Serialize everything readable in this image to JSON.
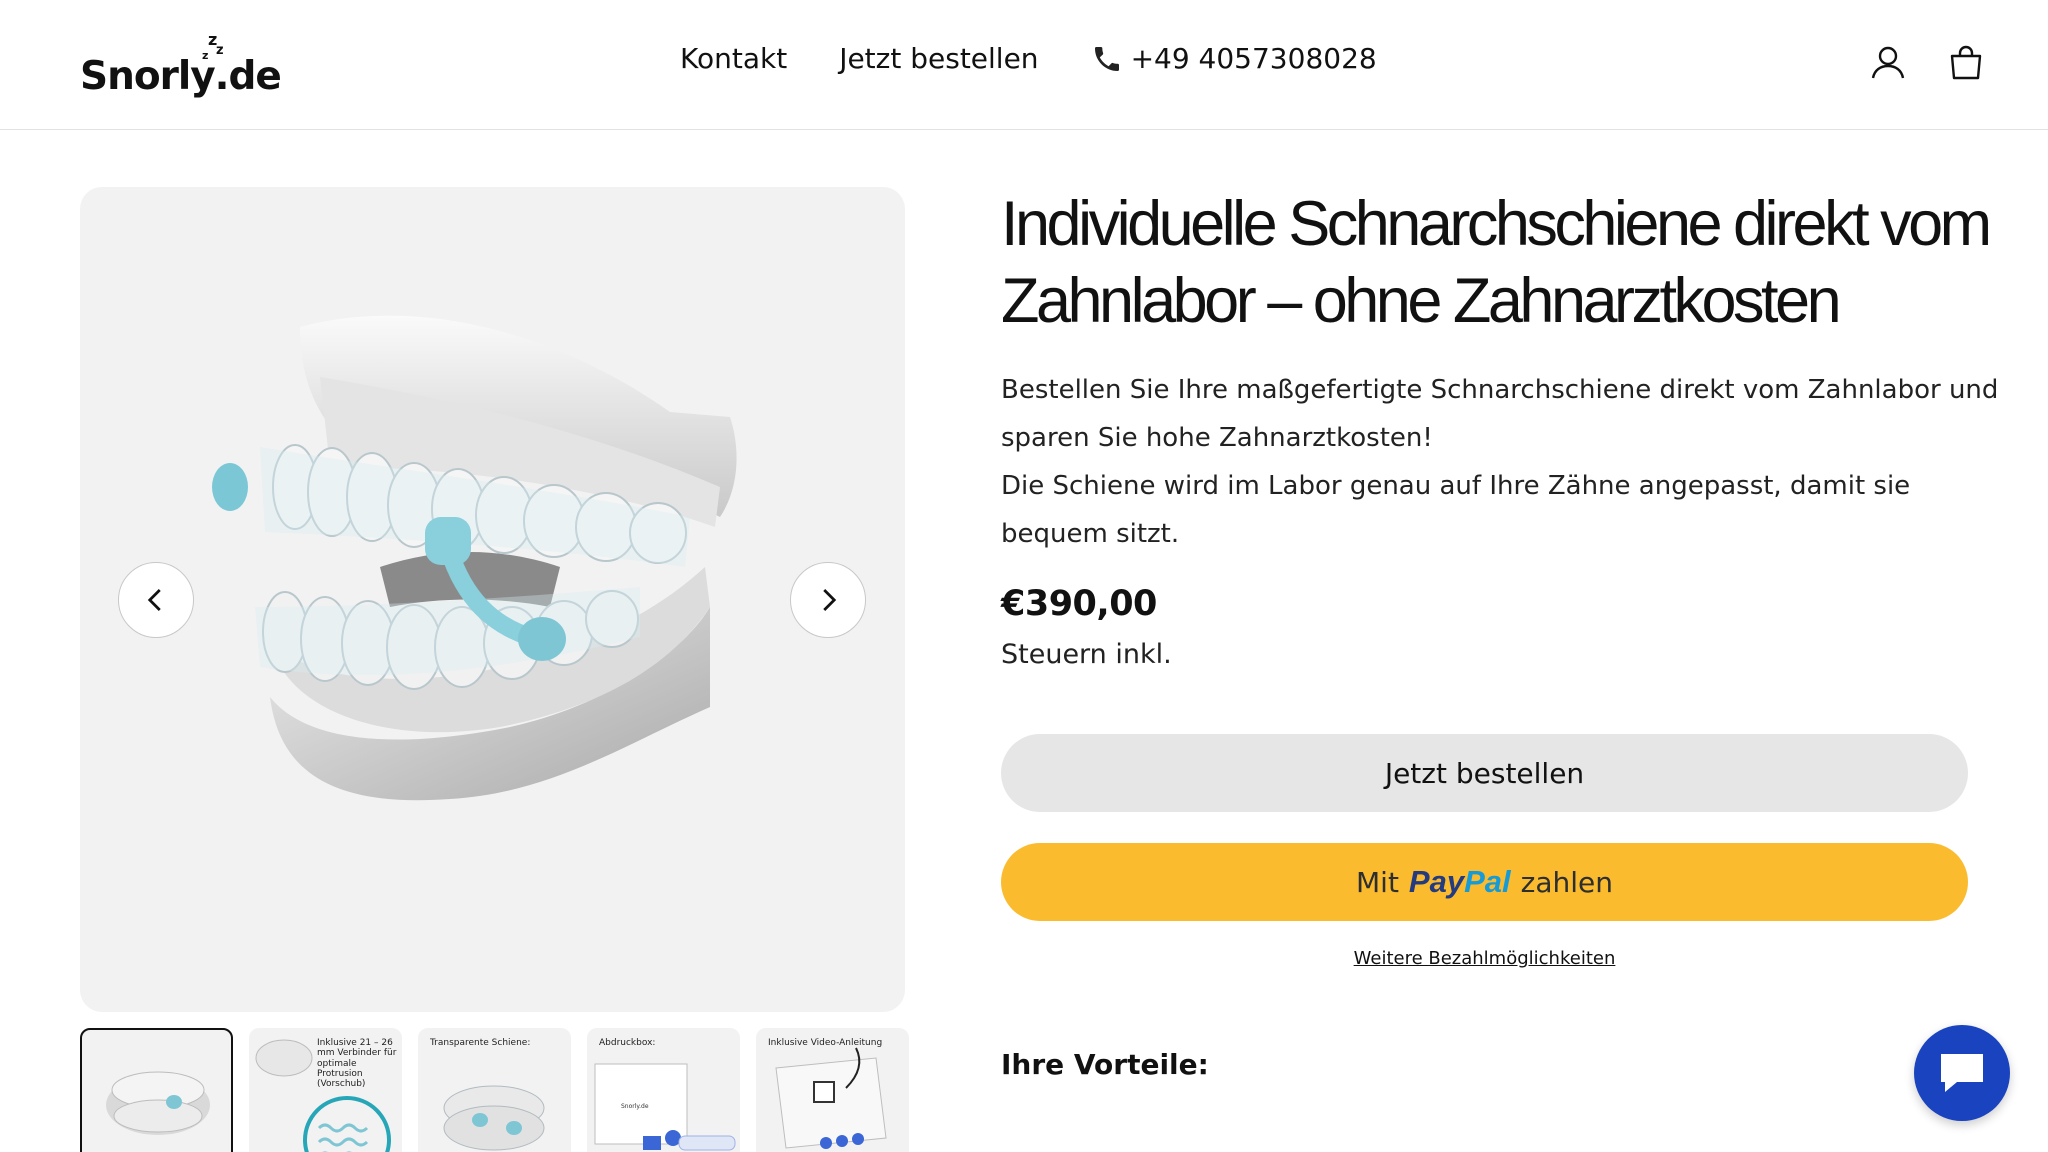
{
  "header": {
    "logo": {
      "name": "Snorly",
      "dot": ".",
      "tld": "de"
    },
    "nav": {
      "contact": "Kontakt",
      "order_now": "Jetzt bestellen",
      "phone": "+49 4057308028"
    },
    "icons": [
      "account-icon",
      "cart-icon"
    ]
  },
  "gallery": {
    "thumbnails": [
      {
        "caption": ""
      },
      {
        "caption": "Inklusive 21 – 26 mm Verbinder für optimale Protrusion (Vorschub)"
      },
      {
        "caption": "Transparente Schiene:"
      },
      {
        "caption": "Abdruckbox:"
      },
      {
        "caption": "Inklusive Video-Anleitung"
      }
    ]
  },
  "product": {
    "title": "Individuelle Schnarchschiene direkt vom Zahnlabor – ohne Zahnarztkosten",
    "description": [
      "Bestellen Sie Ihre maßgefertigte Schnarchschiene direkt vom Zahnlabor und sparen Sie hohe Zahnarztkosten!",
      "Die Schiene wird im Labor genau auf Ihre Zähne angepasst, damit sie bequem sitzt."
    ],
    "price": "€390,00",
    "tax_note": "Steuern inkl.",
    "order_button": "Jetzt bestellen",
    "paypal_button": {
      "prefix": "Mit",
      "brand_pay": "Pay",
      "brand_pal": "Pal",
      "suffix": "zahlen"
    },
    "more_payment": "Weitere Bezahlmöglichkeiten",
    "advantages_heading": "Ihre Vorteile:"
  },
  "colors": {
    "paypal_yellow": "#fbbb2e",
    "order_button_gray": "#e6e6e6",
    "chat_blue": "#1a43bf"
  }
}
